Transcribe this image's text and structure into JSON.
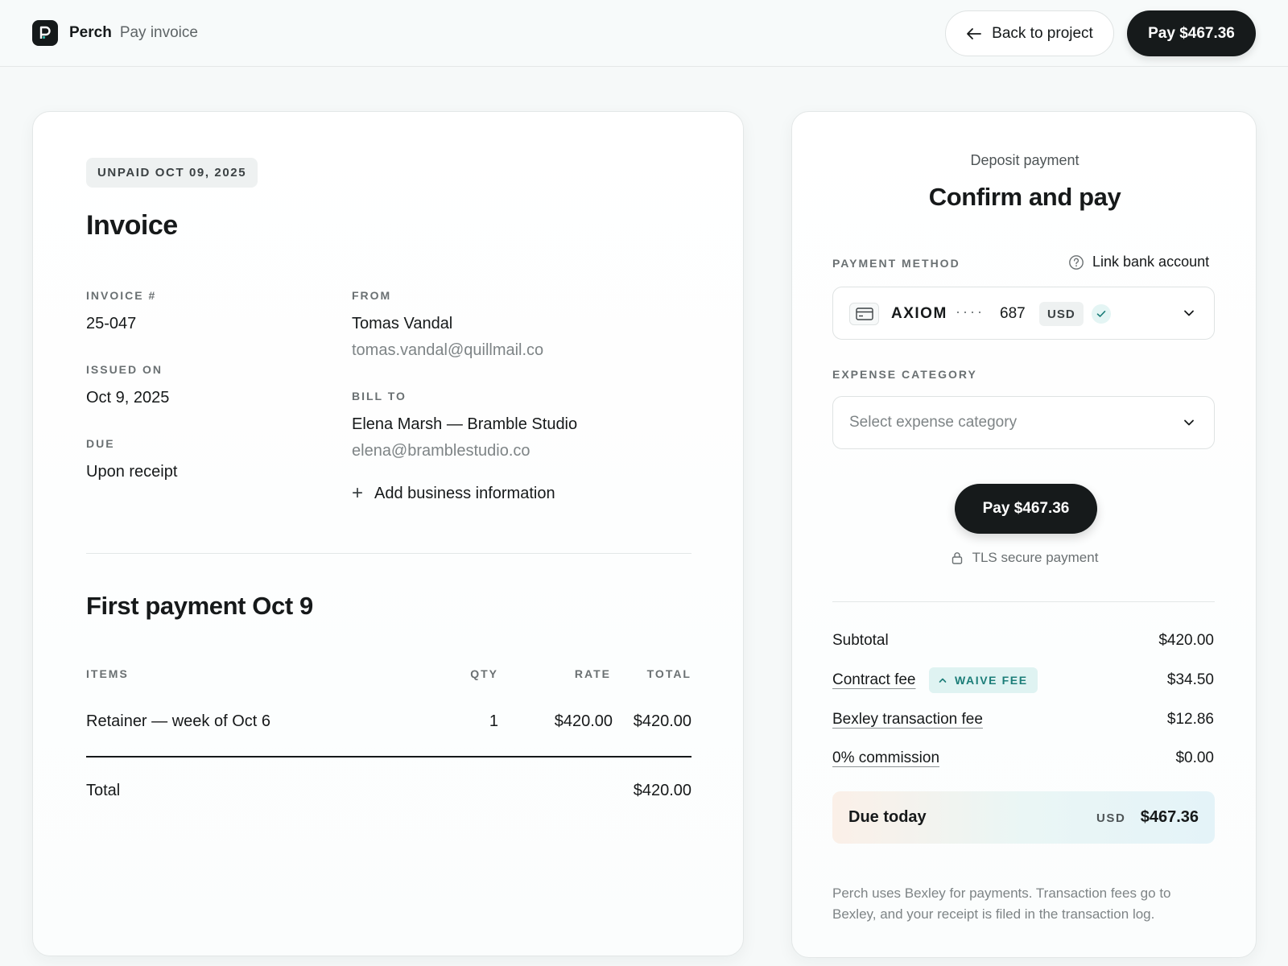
{
  "header": {
    "brand": "Perch",
    "page": "Pay invoice",
    "back_label": "Back to project",
    "pay_label": "Pay $467.36"
  },
  "invoice": {
    "status_badge": "UNPAID OCT 09, 2025",
    "title": "Invoice",
    "invoice_no_label": "INVOICE #",
    "invoice_no": "25-047",
    "issued_label": "ISSUED ON",
    "issued": "Oct 9, 2025",
    "due_label": "DUE",
    "due": "Upon receipt",
    "from_label": "FROM",
    "from_name": "Tomas Vandal",
    "from_email": "tomas.vandal@quillmail.co",
    "bill_to_label": "BILL TO",
    "bill_to_name": "Elena Marsh — Bramble Studio",
    "bill_to_email": "elena@bramblestudio.co",
    "add_business": "Add business information",
    "section_title": "First payment Oct 9",
    "columns": {
      "items": "ITEMS",
      "qty": "QTY",
      "rate": "RATE",
      "total": "TOTAL"
    },
    "line_items": [
      {
        "item": "Retainer — week of Oct 6",
        "qty": "1",
        "rate": "$420.00",
        "total": "$420.00"
      }
    ],
    "total_label": "Total",
    "total_value": "$420.00"
  },
  "payment": {
    "subtitle": "Deposit payment",
    "title": "Confirm and pay",
    "method_label": "PAYMENT METHOD",
    "link_bank": "Link bank account",
    "method": {
      "name": "AXIOM",
      "dots": "····",
      "last4": "687",
      "currency": "USD"
    },
    "expense_label": "EXPENSE CATEGORY",
    "expense_placeholder": "Select expense category",
    "pay_label": "Pay $467.36",
    "secure_label": "TLS secure payment",
    "summary": {
      "subtotal_label": "Subtotal",
      "subtotal": "$420.00",
      "contract_fee_label": "Contract fee",
      "waive_label": "WAIVE FEE",
      "contract_fee": "$34.50",
      "tx_fee_label": "Bexley transaction fee",
      "tx_fee": "$12.86",
      "commission_label": "0% commission",
      "commission": "$0.00"
    },
    "due_today_label": "Due today",
    "due_today_currency": "USD",
    "due_today_amount": "$467.36",
    "footnote": "Perch uses Bexley for payments. Transaction fees go to Bexley, and your receipt is filed in the transaction log."
  },
  "colors": {
    "accent_dark": "#161a1b",
    "teal": "#1b7d78",
    "waive_bg": "#dff3f2"
  }
}
